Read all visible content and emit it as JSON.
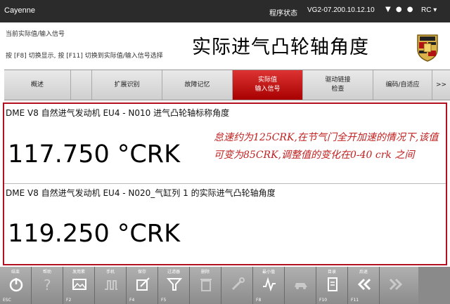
{
  "titlebar": {
    "app_title": "Cayenne",
    "status_label": "程序状态",
    "version": "VG2-07.200.10.12.10",
    "system_icons": "▼ ● ●",
    "rc_label": "RC ▾"
  },
  "header": {
    "line1": "当前实际值/输入信号",
    "line2": "按 [F8] 切换显示, 按 [F11] 切换到实际值/输入信号选择",
    "big_title": "实际进气凸轮轴角度"
  },
  "tabs": [
    {
      "label": "概述"
    },
    {
      "label": ""
    },
    {
      "label": "扩展识别"
    },
    {
      "label": "故障记忆"
    },
    {
      "label": "实际值\n输入信号"
    },
    {
      "label": "驱动链接\n检查"
    },
    {
      "label": "编码/自适应"
    },
    {
      "label": ">>"
    }
  ],
  "rows": [
    {
      "title": "DME V8 自然进气发动机 EU4 - N010  进气凸轮轴标称角度",
      "value": "117.750 °CRK"
    },
    {
      "title": "DME V8 自然进气发动机 EU4 - N020_气缸列 1 的实际进气凸轮轴角度",
      "value": "119.250 °CRK"
    }
  ],
  "note": "怠速约为125CRK,在节气门全开加速的情况下,该值可变为85CRK,调整值的变化在0-40 crk 之间",
  "footer": [
    {
      "cap": "结束",
      "fn": "ESC",
      "icon": "power-icon",
      "dim": false
    },
    {
      "cap": "帮助",
      "fn": "",
      "icon": "help-icon",
      "dim": true
    },
    {
      "cap": "发用素",
      "fn": "F2",
      "icon": "image-icon",
      "dim": false
    },
    {
      "cap": "手机",
      "fn": "",
      "icon": "pulse-icon",
      "dim": true
    },
    {
      "cap": "保存",
      "fn": "F4",
      "icon": "save-icon",
      "dim": false
    },
    {
      "cap": "过滤器",
      "fn": "F5",
      "icon": "filter-icon",
      "dim": false
    },
    {
      "cap": "删除",
      "fn": "",
      "icon": "delete-icon",
      "dim": true
    },
    {
      "cap": "",
      "fn": "",
      "icon": "tool-icon",
      "dim": true
    },
    {
      "cap": "最小值",
      "fn": "F8",
      "icon": "graph-icon",
      "dim": false
    },
    {
      "cap": "",
      "fn": "",
      "icon": "car-icon",
      "dim": true
    },
    {
      "cap": "目录",
      "fn": "F10",
      "icon": "document-icon",
      "dim": false
    },
    {
      "cap": "后退",
      "fn": "F11",
      "icon": "back-icon",
      "dim": false
    },
    {
      "cap": "",
      "fn": "",
      "icon": "forward-icon",
      "dim": true
    }
  ],
  "colors": {
    "accent": "#b01020",
    "active_tab": "#c01818",
    "note": "#c02020"
  }
}
